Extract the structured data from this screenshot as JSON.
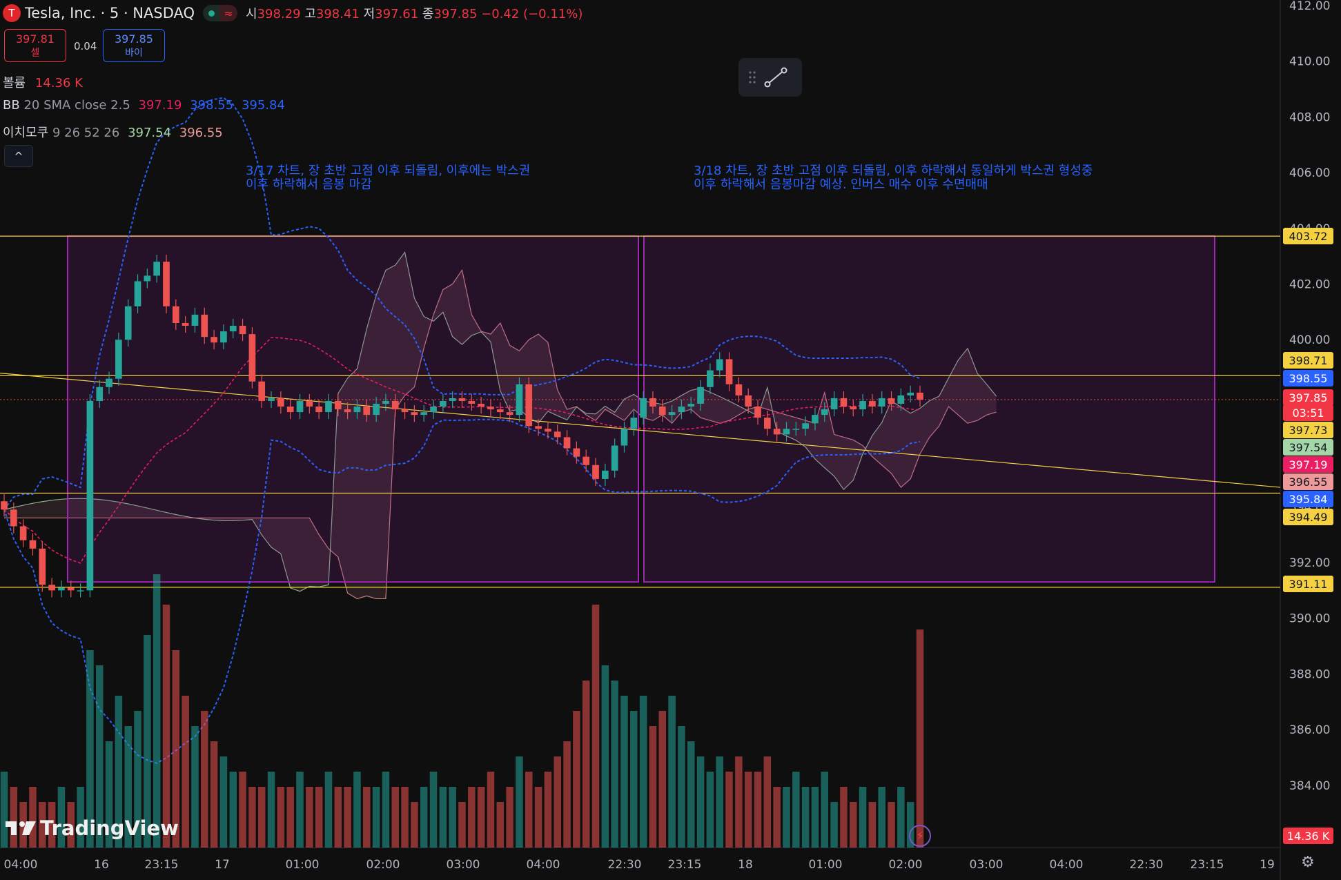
{
  "header": {
    "logo_glyph": "T",
    "symbol": "Tesla, Inc. · 5 · NASDAQ",
    "market_icon": "≈",
    "o_label": "시",
    "o_value": "398.29",
    "h_label": "고",
    "h_value": "398.41",
    "l_label": "저",
    "l_value": "397.61",
    "c_label": "종",
    "c_value": "397.85",
    "change": "−0.42 (−0.11%)"
  },
  "trade": {
    "sell_price": "397.81",
    "sell_label": "셀",
    "spread": "0.04",
    "buy_price": "397.85",
    "buy_label": "바이"
  },
  "legend": {
    "volume_label": "볼륨",
    "volume_value": "14.36 K",
    "bb_label": "BB",
    "bb_params": "20 SMA close 2.5",
    "bb_mid": "397.19",
    "bb_upper": "398.55",
    "bb_lower": "395.84",
    "ichimoku_label": "이치모쿠",
    "ichimoku_params": "9 26 52 26",
    "ichi_a": "397.54",
    "ichi_b": "396.55",
    "collapse_icon": "^"
  },
  "notes": {
    "left": "3/17 차트, 장 초반 고점 이후 되돌림, 이후에는 박스권\n이후 하락해서 음봉 마감",
    "right": "3/18 차트, 장 초반 고점 이후 되돌림, 이후 하락해서 동일하게 박스권 형성중\n이후 하락해서 음봉마감 예상. 인버스 매수 이후 수면매매"
  },
  "colors": {
    "up": "#26a69a",
    "down": "#ef5350",
    "bb": "#2962ff",
    "bb_mid": "#e91e63",
    "box": "#9c27b0",
    "hline": "#f5d142",
    "ichi_a": "#a5d6a7",
    "ichi_b": "#ef9a9a",
    "note": "#2962ff"
  },
  "chart_data": {
    "type": "candlestick",
    "symbol": "TSLA",
    "interval": "5",
    "y_ticks": [
      "412.00",
      "410.00",
      "408.00",
      "406.00",
      "404.00",
      "402.00",
      "400.00",
      "398.00",
      "396.00",
      "394.00",
      "392.00",
      "390.00",
      "388.00",
      "386.00",
      "384.00"
    ],
    "x_ticks": [
      "04:00",
      "16",
      "23:15",
      "17",
      "01:00",
      "02:00",
      "03:00",
      "04:00",
      "22:30",
      "23:15",
      "18",
      "01:00",
      "02:00",
      "03:00",
      "04:00",
      "22:30",
      "23:15",
      "19"
    ],
    "horizontal_levels": [
      403.72,
      398.71,
      391.11,
      394.49
    ],
    "price_tags": [
      {
        "value": "403.72",
        "kind": "level"
      },
      {
        "value": "398.71",
        "kind": "level"
      },
      {
        "value": "398.55",
        "kind": "bb_upper"
      },
      {
        "value": "397.85",
        "kind": "last"
      },
      {
        "value": "03:51",
        "kind": "countdown"
      },
      {
        "value": "397.73",
        "kind": "level"
      },
      {
        "value": "397.54",
        "kind": "ichi_a"
      },
      {
        "value": "397.19",
        "kind": "bb_mid"
      },
      {
        "value": "396.55",
        "kind": "ichi_b"
      },
      {
        "value": "395.84",
        "kind": "bb_lower"
      },
      {
        "value": "394.49",
        "kind": "level"
      },
      {
        "value": "391.11",
        "kind": "level"
      },
      {
        "value": "14.36 K",
        "kind": "volume"
      }
    ],
    "boxes": [
      {
        "name": "3/17 session box",
        "top": 403.72,
        "bottom": 391.3
      },
      {
        "name": "3/18 session box",
        "top": 403.72,
        "bottom": 391.3
      }
    ],
    "closes": [
      393.9,
      393.3,
      392.8,
      392.5,
      391.2,
      391.0,
      391.1,
      391.0,
      391.0,
      397.8,
      398.3,
      398.6,
      400.0,
      401.2,
      402.1,
      402.3,
      402.8,
      401.2,
      400.6,
      400.5,
      400.9,
      400.1,
      399.9,
      400.3,
      400.5,
      400.2,
      398.5,
      397.8,
      397.9,
      397.6,
      397.4,
      397.8,
      397.6,
      397.4,
      397.8,
      397.5,
      397.4,
      397.6,
      397.3,
      397.7,
      397.8,
      397.5,
      397.4,
      397.3,
      397.4,
      397.6,
      397.8,
      397.9,
      397.8,
      397.7,
      397.6,
      397.5,
      397.4,
      397.3,
      398.4,
      396.9,
      396.8,
      396.7,
      396.5,
      396.1,
      395.8,
      395.5,
      395.0,
      395.3,
      396.2,
      396.8,
      397.2,
      397.9,
      397.6,
      397.3,
      397.4,
      397.6,
      397.7,
      398.3,
      398.9,
      399.3,
      398.4,
      398.0,
      397.6,
      397.2,
      396.8,
      396.6,
      396.8,
      396.8,
      397.0,
      397.3,
      397.5,
      397.9,
      397.6,
      397.5,
      397.8,
      397.6,
      397.9,
      397.7,
      398.0,
      398.1,
      397.85
    ],
    "volumes_k": [
      5,
      4,
      3,
      4,
      3,
      3,
      4,
      3,
      4,
      13,
      12,
      7,
      10,
      8,
      9,
      14,
      18,
      16,
      13,
      10,
      8,
      9,
      7,
      6,
      5,
      5,
      4,
      4,
      5,
      4,
      4,
      5,
      4,
      4,
      5,
      4,
      4,
      5,
      4,
      4,
      5,
      4,
      4,
      3,
      4,
      5,
      4,
      4,
      3,
      4,
      4,
      5,
      3,
      4,
      6,
      5,
      4,
      5,
      6,
      7,
      9,
      11,
      16,
      12,
      11,
      10,
      9,
      10,
      8,
      9,
      10,
      8,
      7,
      6,
      5,
      6,
      5,
      6,
      5,
      5,
      6,
      4,
      4,
      5,
      4,
      4,
      5,
      3,
      4,
      3,
      4,
      3,
      4,
      3,
      4,
      3,
      14.36
    ]
  }
}
